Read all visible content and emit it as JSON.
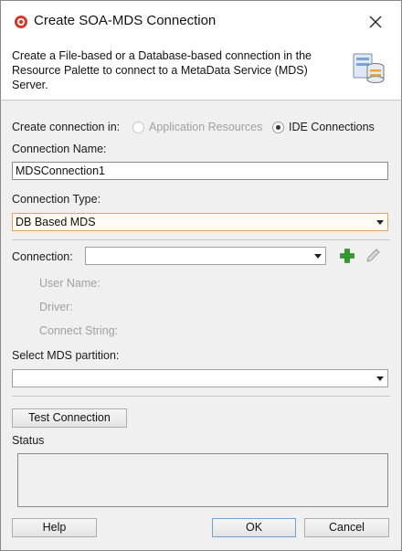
{
  "window": {
    "title": "Create SOA-MDS Connection",
    "description": "Create a File-based or a Database-based connection in the Resource Palette to connect to a MetaData Service (MDS) Server."
  },
  "create_in": {
    "label": "Create connection in:",
    "options": [
      {
        "label": "Application Resources",
        "selected": false,
        "enabled": false
      },
      {
        "label": "IDE Connections",
        "selected": true,
        "enabled": true
      }
    ]
  },
  "connection_name": {
    "label": "Connection Name:",
    "value": "MDSConnection1"
  },
  "connection_type": {
    "label": "Connection Type:",
    "value": "DB Based MDS"
  },
  "connection": {
    "label": "Connection:",
    "value": "",
    "details": {
      "user_name": "User Name:",
      "driver": "Driver:",
      "connect_string": "Connect String:"
    }
  },
  "partition": {
    "label": "Select MDS partition:",
    "value": ""
  },
  "test_button": "Test Connection",
  "status": {
    "label": "Status",
    "text": ""
  },
  "footer": {
    "help": "Help",
    "ok": "OK",
    "cancel": "Cancel"
  },
  "colors": {
    "accent_focus": "#e3a35b",
    "add_icon": "#2e9b2e",
    "disabled_text": "#a0a0a0"
  },
  "icons": [
    "app-icon",
    "close-icon",
    "database-icon",
    "add-icon",
    "edit-icon",
    "chevron-down-icon"
  ]
}
